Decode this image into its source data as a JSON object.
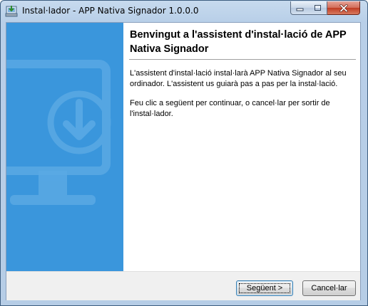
{
  "window": {
    "title": "Instal·lador - APP Nativa Signador 1.0.0.0",
    "controls": {
      "minimize_icon": "minimize-icon",
      "maximize_icon": "maximize-icon",
      "close_icon": "close-icon"
    }
  },
  "banner": {
    "icon": "monitor-download-icon",
    "color": "#3a96dc"
  },
  "main": {
    "heading": "Benvingut a l'assistent d'instal·lació de APP Nativa Signador",
    "paragraph1": "L'assistent d'instal·lació instal·larà APP Nativa Signador al seu ordinador. L'assistent us guiarà pas a pas per la instal·lació.",
    "paragraph2": "Feu clic a següent per continuar, o cancel·lar per sortir de l'instal·lador."
  },
  "buttons": {
    "next_label": "Següent >",
    "cancel_label": "Cancel·lar"
  }
}
